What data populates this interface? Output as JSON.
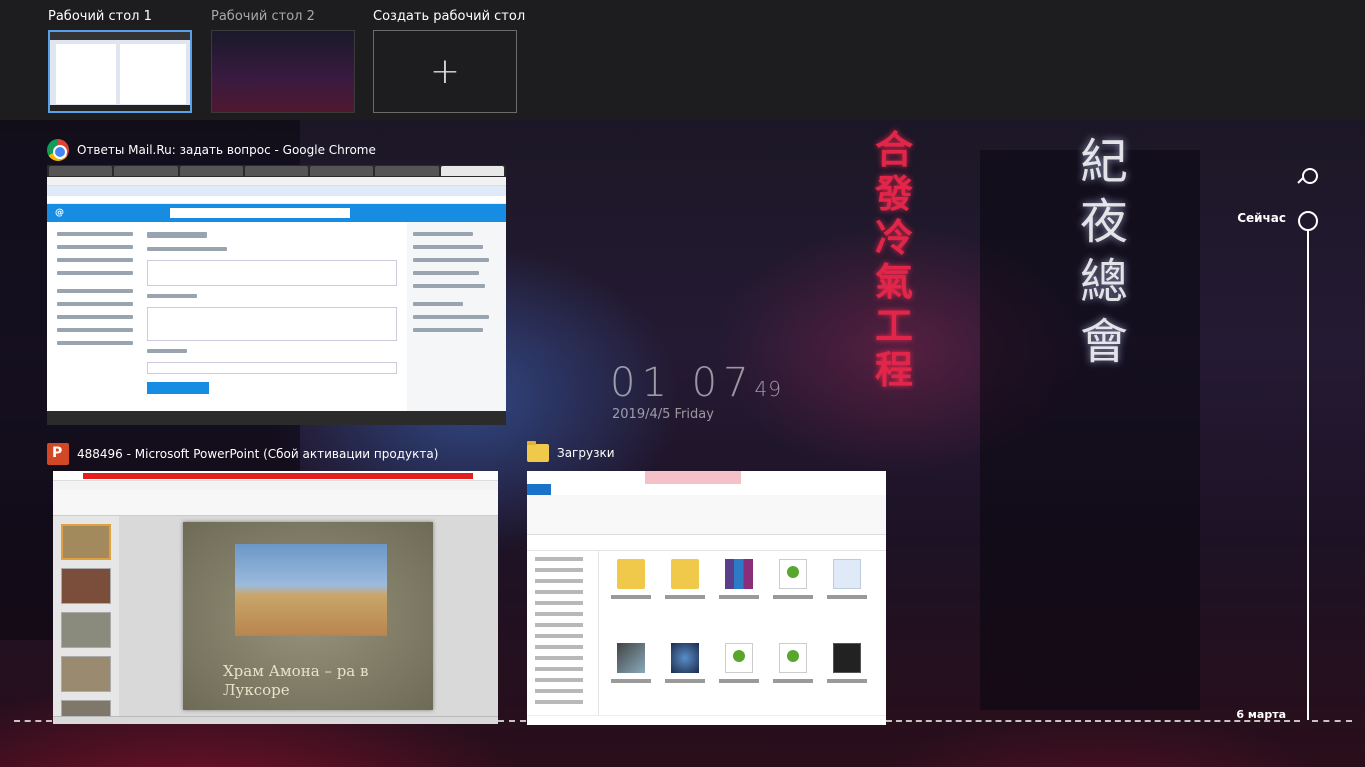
{
  "desktops": [
    {
      "label": "Рабочий стол 1",
      "active": true
    },
    {
      "label": "Рабочий стол 2",
      "active": false
    }
  ],
  "new_desktop": {
    "label": "Создать рабочий стол",
    "icon": "plus-icon"
  },
  "windows": {
    "chrome": {
      "title": "Ответы Mail.Ru: задать вопрос - Google Chrome",
      "icon": "chrome-icon"
    },
    "powerpoint": {
      "title": "488496 - Microsoft PowerPoint (Сбой активации продукта)",
      "icon": "powerpoint-icon",
      "slide_text": "Храм Амона – ра в Луксоре"
    },
    "explorer": {
      "title": "Загрузки",
      "icon": "folder-icon"
    }
  },
  "clock": {
    "time_hh": "01",
    "time_mm": "07",
    "time_ss": "49",
    "date": "2019/4/5 Friday"
  },
  "timeline": {
    "now_label": "Сейчас",
    "date_label": "6 марта",
    "search_icon": "search-icon"
  },
  "colors": {
    "accent": "#5aa0e8",
    "topbar": "#1d1d1f"
  }
}
